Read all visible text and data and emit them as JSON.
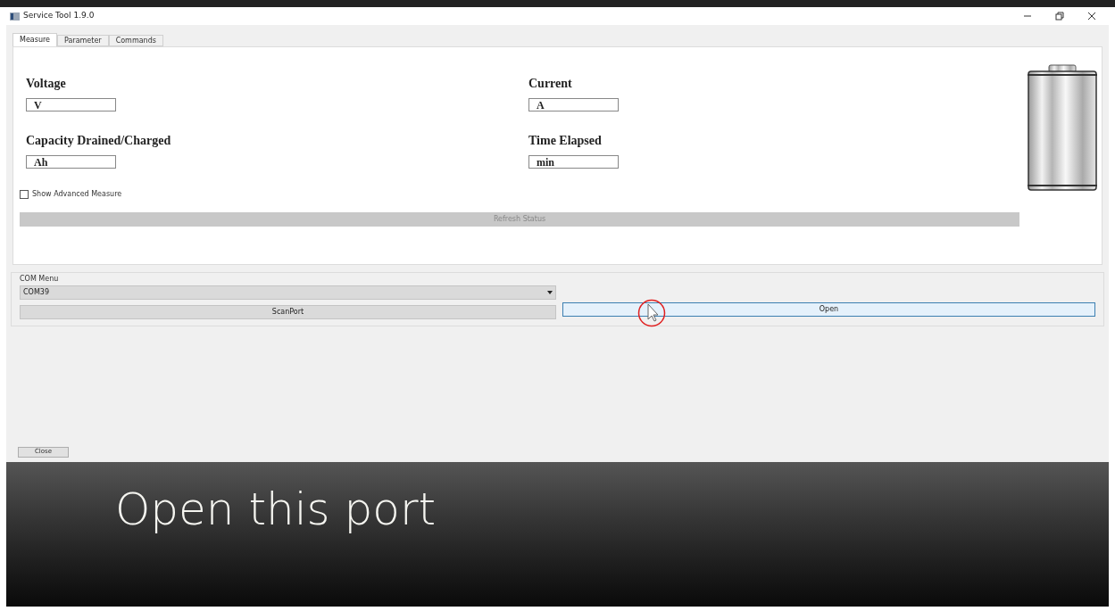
{
  "window": {
    "title": "Service Tool 1.9.0"
  },
  "tabs": [
    {
      "label": "Measure",
      "selected": true
    },
    {
      "label": "Parameter",
      "selected": false
    },
    {
      "label": "Commands",
      "selected": false
    }
  ],
  "measure": {
    "fields": [
      {
        "label": "Voltage",
        "unit": "V"
      },
      {
        "label": "Current",
        "unit": "A"
      },
      {
        "label": "Capacity Drained/Charged",
        "unit": "Ah"
      },
      {
        "label": "Time Elapsed",
        "unit": "min"
      }
    ],
    "advanced": {
      "label": "Show Advanced Measure",
      "checked": false
    },
    "refresh_button": {
      "label": "Refresh Status",
      "disabled": true
    }
  },
  "com_menu": {
    "title": "COM Menu",
    "port": "COM39",
    "scan_button": {
      "label": "ScanPort"
    },
    "open_button": {
      "label": "Open",
      "hovered": true
    }
  },
  "close_button": {
    "label": "Close"
  },
  "caption": "Open this port"
}
